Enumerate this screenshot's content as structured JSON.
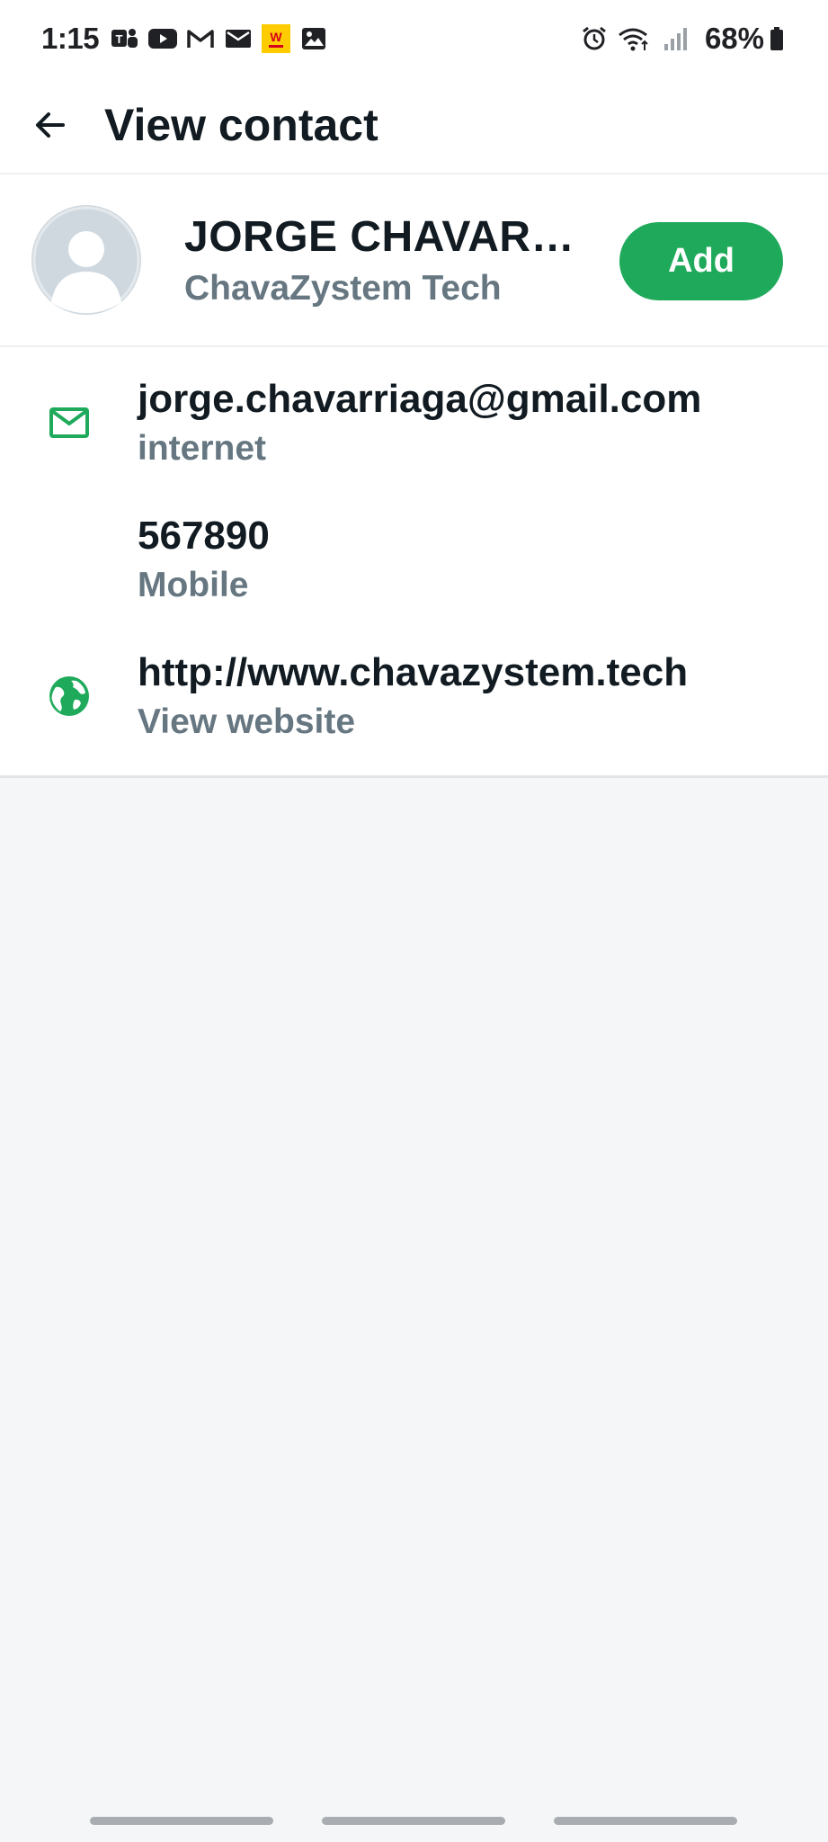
{
  "status_bar": {
    "time": "1:15",
    "battery_percent": "68%",
    "notification_icons": [
      "teams-icon",
      "youtube-icon",
      "gmail-icon",
      "mail-icon",
      "w-app-icon",
      "gallery-icon"
    ],
    "system_icons": [
      "alarm-icon",
      "wifi-icon",
      "signal-icon",
      "battery-icon"
    ]
  },
  "header": {
    "title": "View contact"
  },
  "contact": {
    "name": "JORGE CHAVARR…",
    "company": "ChavaZystem Tech",
    "add_label": "Add"
  },
  "details": [
    {
      "icon": "email-icon",
      "value": "jorge.chavarriaga@gmail.com",
      "label": "internet"
    },
    {
      "icon": "",
      "value": "567890",
      "label": "Mobile"
    },
    {
      "icon": "globe-icon",
      "value": "http://www.chavazystem.tech",
      "label": "View website"
    }
  ],
  "colors": {
    "accent": "#1faa5b",
    "secondary_text": "#667781",
    "primary_text": "#111b21",
    "background": "#f4f6f8"
  }
}
